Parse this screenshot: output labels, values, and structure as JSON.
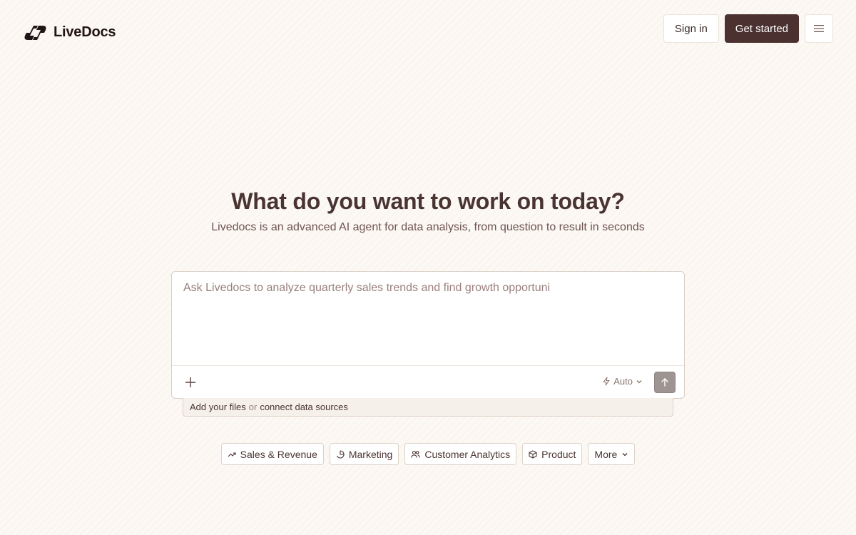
{
  "header": {
    "brand": "LiveDocs",
    "sign_in": "Sign in",
    "get_started": "Get started"
  },
  "hero": {
    "title": "What do you want to work on today?",
    "subtitle": "Livedocs is an advanced AI agent for data analysis, from question to result in seconds"
  },
  "prompt": {
    "placeholder": "Ask Livedocs to analyze quarterly sales trends and find growth opportuni",
    "mode": "Auto"
  },
  "sources": {
    "add_files": "Add your files",
    "or": "or",
    "connect": "connect data sources"
  },
  "chips": [
    {
      "label": "Sales & Revenue",
      "icon": "trending-up-icon"
    },
    {
      "label": "Marketing",
      "icon": "pie-chart-icon"
    },
    {
      "label": "Customer Analytics",
      "icon": "users-icon"
    },
    {
      "label": "Product",
      "icon": "box-icon"
    },
    {
      "label": "More",
      "icon": "chevron-down-icon"
    }
  ],
  "colors": {
    "accent": "#4b3230",
    "background": "#fcf8f3",
    "text": "#4a3432",
    "muted": "#9a807d"
  }
}
